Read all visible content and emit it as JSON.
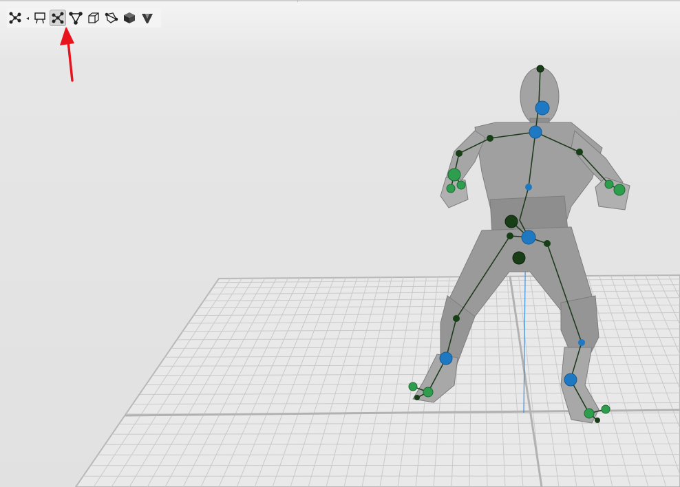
{
  "app": {
    "view": "3d-viewport"
  },
  "toolbar": {
    "tools": [
      {
        "name": "skeleton-mode-icon",
        "active": false
      },
      {
        "name": "camera-view-icon",
        "active": false
      },
      {
        "name": "joints-tool-icon",
        "active": true
      },
      {
        "name": "bones-tool-icon",
        "active": false
      },
      {
        "name": "wireframe-box-icon",
        "active": false
      },
      {
        "name": "edit-mesh-icon",
        "active": false
      },
      {
        "name": "solid-box-icon",
        "active": false
      },
      {
        "name": "shading-mode-icon",
        "active": false
      }
    ]
  },
  "annotation": {
    "arrow_color": "#e8141d",
    "points_to": "joints-tool-icon"
  },
  "colors": {
    "grid": "#c8c8c8",
    "grid_major": "#b4b4b4",
    "bone": "#1f3b1f",
    "joint_dark": "#173e17",
    "joint_green": "#2e9e4e",
    "joint_blue": "#1f79c2",
    "axis_line": "#3a8fe0",
    "model": "#9a9a9a"
  }
}
